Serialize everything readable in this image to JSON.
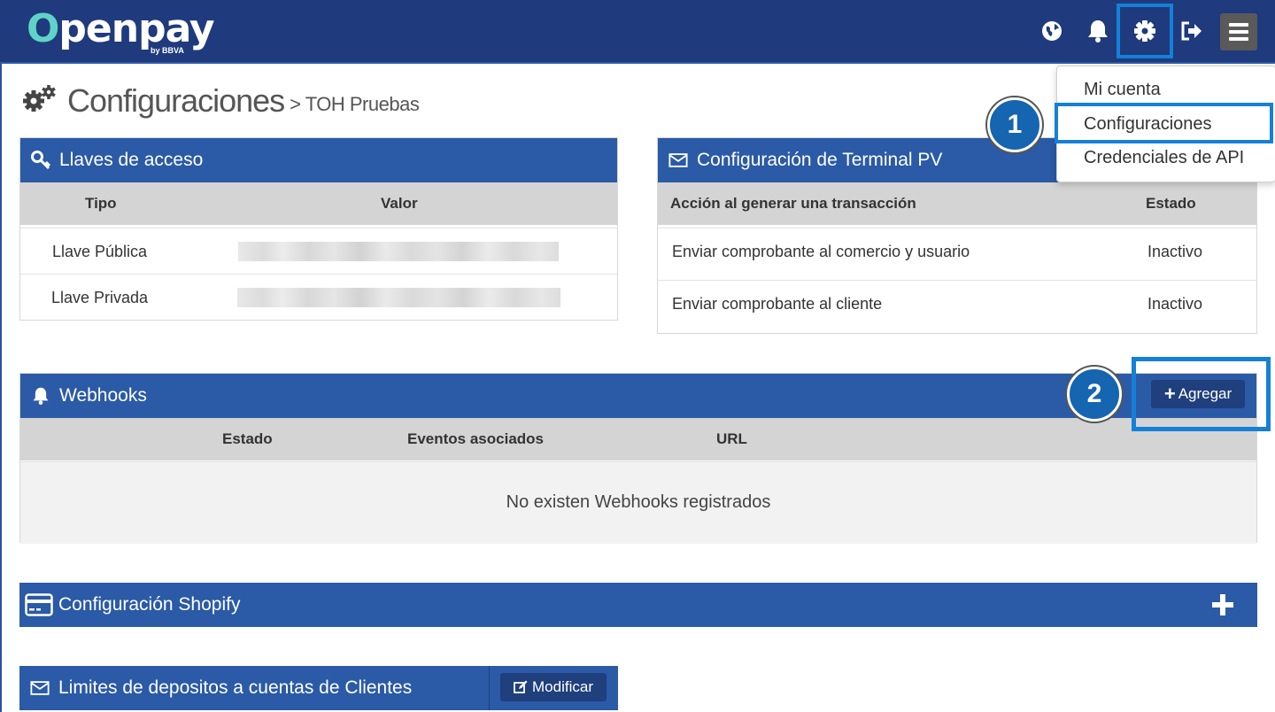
{
  "app": {
    "logo_text_pre": "O",
    "logo_text_post": "penpay",
    "logo_sub": "by BBVA"
  },
  "navbar": {
    "icons": [
      "globe-icon",
      "bell-icon",
      "gear-icon",
      "sign-out-icon",
      "hamburger-menu-icon"
    ]
  },
  "page": {
    "title": "Configuraciones",
    "subtitle": "> TOH Pruebas"
  },
  "dropdown": {
    "items": [
      {
        "label": "Mi cuenta"
      },
      {
        "label": "Configuraciones"
      },
      {
        "label": "Credenciales de API"
      }
    ]
  },
  "callouts": {
    "one": "1",
    "two": "2"
  },
  "keys_panel": {
    "title": "Llaves de acceso",
    "columns": [
      "Tipo",
      "Valor"
    ],
    "rows": [
      {
        "tipo": "Llave Pública"
      },
      {
        "tipo": "Llave Privada"
      }
    ]
  },
  "terminal_panel": {
    "title": "Configuración de Terminal PV",
    "columns": [
      "Acción al generar una transacción",
      "Estado"
    ],
    "rows": [
      {
        "accion": "Enviar comprobante al comercio y usuario",
        "estado": "Inactivo"
      },
      {
        "accion": "Enviar comprobante al cliente",
        "estado": "Inactivo"
      }
    ]
  },
  "webhooks_panel": {
    "title": "Webhooks",
    "add_label": "Agregar",
    "columns": [
      "Estado",
      "Eventos asociados",
      "URL"
    ],
    "empty_text": "No existen Webhooks registrados"
  },
  "shopify_panel": {
    "title": "Configuración Shopify"
  },
  "limits_panel": {
    "title": "Limites de depositos a cuentas de Clientes",
    "modify_label": "Modificar"
  },
  "colors": {
    "navbar": "#1f3a7d",
    "panel_header": "#2b5aa6",
    "highlight": "#1480d8",
    "button": "#1f3f7d",
    "brand_accent": "#5fd3c6"
  }
}
